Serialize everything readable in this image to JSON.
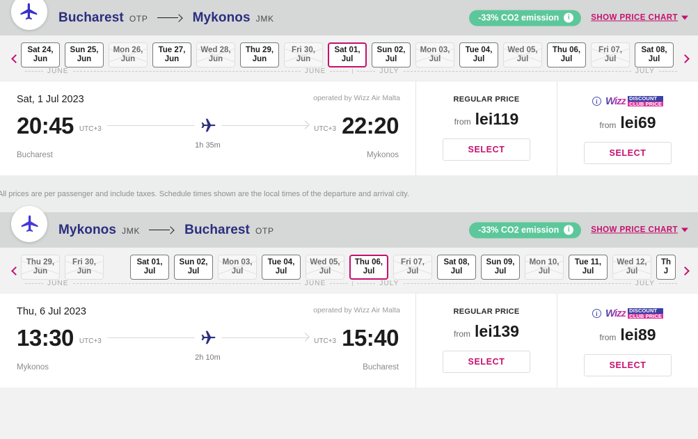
{
  "journeys": [
    {
      "id": "outbound",
      "plane_icon": "plane-right-icon",
      "origin": "Bucharest",
      "origin_code": "OTP",
      "destination": "Mykonos",
      "destination_code": "JMK",
      "co2_label": "-33% CO2 emission",
      "co2_info_icon": "info-icon",
      "price_chart_label": "SHOW PRICE CHART",
      "months": [
        "JUNE",
        "JUNE",
        "JULY",
        "JULY"
      ],
      "dates": [
        {
          "line1": "Sat 24,",
          "line2": "Jun",
          "state": "available"
        },
        {
          "line1": "Sun 25,",
          "line2": "Jun",
          "state": "available"
        },
        {
          "line1": "Mon 26,",
          "line2": "Jun",
          "state": "unavailable"
        },
        {
          "line1": "Tue 27,",
          "line2": "Jun",
          "state": "available"
        },
        {
          "line1": "Wed 28,",
          "line2": "Jun",
          "state": "unavailable"
        },
        {
          "line1": "Thu 29,",
          "line2": "Jun",
          "state": "available"
        },
        {
          "line1": "Fri 30,",
          "line2": "Jun",
          "state": "unavailable"
        },
        {
          "line1": "Sat 01,",
          "line2": "Jul",
          "state": "selected"
        },
        {
          "line1": "Sun 02,",
          "line2": "Jul",
          "state": "available"
        },
        {
          "line1": "Mon 03,",
          "line2": "Jul",
          "state": "unavailable"
        },
        {
          "line1": "Tue 04,",
          "line2": "Jul",
          "state": "available"
        },
        {
          "line1": "Wed 05,",
          "line2": "Jul",
          "state": "unavailable"
        },
        {
          "line1": "Thu 06,",
          "line2": "Jul",
          "state": "available"
        },
        {
          "line1": "Fri 07,",
          "line2": "Jul",
          "state": "unavailable"
        },
        {
          "line1": "Sat 08,",
          "line2": "Jul",
          "state": "available"
        }
      ],
      "flight": {
        "date": "Sat, 1 Jul 2023",
        "operator": "operated by Wizz Air Malta",
        "depart_time": "20:45",
        "depart_utc": "UTC+3",
        "depart_city": "Bucharest",
        "arrive_time": "22:20",
        "arrive_utc": "UTC+3",
        "arrive_city": "Mykonos",
        "duration": "1h 35m"
      },
      "prices": [
        {
          "kind": "regular",
          "title": "REGULAR PRICE",
          "from_label": "from",
          "value": "lei119",
          "select_label": "SELECT"
        },
        {
          "kind": "discount-club",
          "title_wizz": "Wizz",
          "title_line1": "DISCOUNT",
          "title_line2": "CLUB PRICE",
          "from_label": "from",
          "value": "lei69",
          "select_label": "SELECT"
        }
      ]
    },
    {
      "id": "return",
      "plane_icon": "plane-left-icon",
      "origin": "Mykonos",
      "origin_code": "JMK",
      "destination": "Bucharest",
      "destination_code": "OTP",
      "co2_label": "-33% CO2 emission",
      "co2_info_icon": "info-icon",
      "price_chart_label": "SHOW PRICE CHART",
      "months": [
        "JUNE",
        "JUNE",
        "JULY",
        "JULY"
      ],
      "dates": [
        {
          "line1": "Thu 29,",
          "line2": "Jun",
          "state": "unavailable"
        },
        {
          "line1": "Fri 30,",
          "line2": "Jun",
          "state": "unavailable"
        },
        {
          "line1": "Sat 01,",
          "line2": "Jul",
          "state": "available",
          "gap": true
        },
        {
          "line1": "Sun 02,",
          "line2": "Jul",
          "state": "available"
        },
        {
          "line1": "Mon 03,",
          "line2": "Jul",
          "state": "unavailable"
        },
        {
          "line1": "Tue 04,",
          "line2": "Jul",
          "state": "available"
        },
        {
          "line1": "Wed 05,",
          "line2": "Jul",
          "state": "unavailable"
        },
        {
          "line1": "Thu 06,",
          "line2": "Jul",
          "state": "selected"
        },
        {
          "line1": "Fri 07,",
          "line2": "Jul",
          "state": "unavailable"
        },
        {
          "line1": "Sat 08,",
          "line2": "Jul",
          "state": "available"
        },
        {
          "line1": "Sun 09,",
          "line2": "Jul",
          "state": "available"
        },
        {
          "line1": "Mon 10,",
          "line2": "Jul",
          "state": "unavailable"
        },
        {
          "line1": "Tue 11,",
          "line2": "Jul",
          "state": "available"
        },
        {
          "line1": "Wed 12,",
          "line2": "Jul",
          "state": "unavailable"
        },
        {
          "line1": "Th",
          "line2": "J",
          "state": "available",
          "clipped": true
        }
      ],
      "flight": {
        "date": "Thu, 6 Jul 2023",
        "operator": "operated by Wizz Air Malta",
        "depart_time": "13:30",
        "depart_utc": "UTC+3",
        "depart_city": "Mykonos",
        "arrive_time": "15:40",
        "arrive_utc": "UTC+3",
        "arrive_city": "Bucharest",
        "duration": "2h 10m"
      },
      "prices": [
        {
          "kind": "regular",
          "title": "REGULAR PRICE",
          "from_label": "from",
          "value": "lei139",
          "select_label": "SELECT"
        },
        {
          "kind": "discount-club",
          "title_wizz": "Wizz",
          "title_line1": "DISCOUNT",
          "title_line2": "CLUB PRICE",
          "from_label": "from",
          "value": "lei89",
          "select_label": "SELECT"
        }
      ]
    }
  ],
  "disclaimer": "All prices are per passenger and include taxes. Schedule times shown are the local times of the departure and arrival city.",
  "colors": {
    "brand_magenta": "#c6106e",
    "brand_navy": "#2b2f7e",
    "co2_green": "#5cc79a",
    "header_gray": "#d6d7d7"
  }
}
